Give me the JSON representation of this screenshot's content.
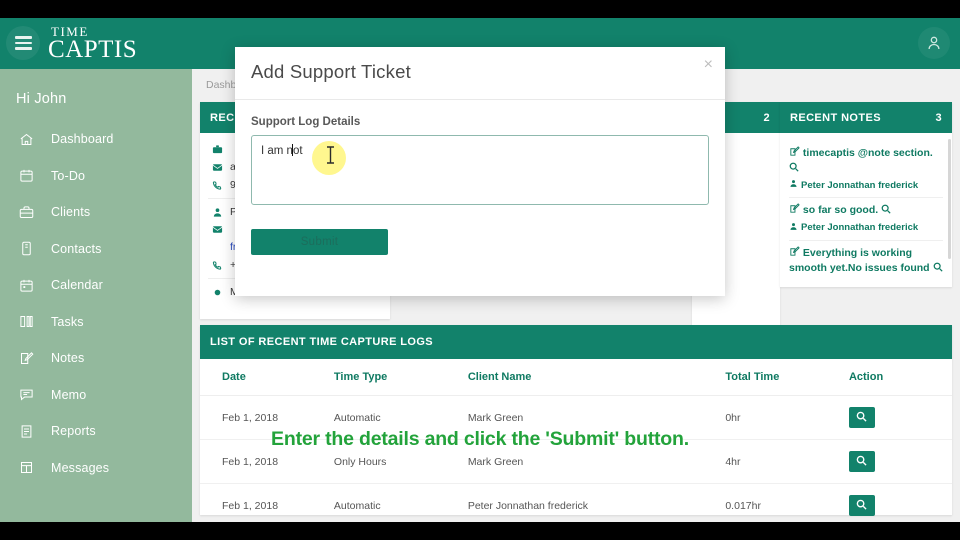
{
  "colors": {
    "brand_teal": "#12826b",
    "sidebar_sage": "#93b99d",
    "instruction_green": "#23a33b",
    "highlight_yellow": "#fff24a"
  },
  "header": {
    "brand_line1": "TIME",
    "brand_line2": "CAPTIS",
    "hamburger_icon": "hamburger-menu-icon",
    "user_icon": "user-avatar-icon"
  },
  "sidebar": {
    "greeting": "Hi John",
    "items": [
      {
        "label": "Dashboard",
        "icon": "home-icon"
      },
      {
        "label": "To-Do",
        "icon": "calendar-check-icon"
      },
      {
        "label": "Clients",
        "icon": "briefcase-icon"
      },
      {
        "label": "Contacts",
        "icon": "contact-card-icon"
      },
      {
        "label": "Calendar",
        "icon": "calendar-icon"
      },
      {
        "label": "Tasks",
        "icon": "tasks-columns-icon"
      },
      {
        "label": "Notes",
        "icon": "note-pencil-icon"
      },
      {
        "label": "Memo",
        "icon": "memo-bubble-icon"
      },
      {
        "label": "Reports",
        "icon": "report-document-icon"
      },
      {
        "label": "Messages",
        "icon": "messages-icon"
      }
    ]
  },
  "main": {
    "breadcrumb": "Dashboard",
    "contacts_card": {
      "title": "RECENT CONTACTS",
      "rows": [
        {
          "icon": "briefcase-icon",
          "text": ""
        },
        {
          "icon": "envelope-icon",
          "text": "a"
        },
        {
          "icon": "phone-icon",
          "text": "9"
        },
        {
          "icon": "person-icon",
          "text": "P"
        },
        {
          "icon": "envelope-icon",
          "text": ""
        },
        {
          "icon": "link-icon",
          "text": "fre",
          "is_link": true
        },
        {
          "icon": "phone-icon",
          "text": "+"
        },
        {
          "icon": "dot-icon",
          "text": "Mark Green"
        }
      ]
    },
    "tasks_card": {
      "badge": "2"
    },
    "notes_card": {
      "title": "RECENT NOTES",
      "badge": "3",
      "items": [
        {
          "text": "timecaptis @note section.",
          "author": "Peter Jonnathan frederick"
        },
        {
          "text": "so far so good.",
          "author": "Peter Jonnathan frederick"
        },
        {
          "text": "Everything is working smooth yet.No issues found",
          "author": ""
        }
      ]
    },
    "logs_card": {
      "title": "LIST OF RECENT TIME CAPTURE LOGS",
      "columns": [
        "Date",
        "Time Type",
        "Client Name",
        "Total Time",
        "Action"
      ],
      "rows": [
        {
          "date": "Feb 1, 2018",
          "type": "Automatic",
          "client": "Mark Green",
          "total": "0hr",
          "action_icon": "search-icon"
        },
        {
          "date": "Feb 1, 2018",
          "type": "Only Hours",
          "client": "Mark Green",
          "total": "4hr",
          "action_icon": "search-icon"
        },
        {
          "date": "Feb 1, 2018",
          "type": "Automatic",
          "client": "Peter Jonnathan frederick",
          "total": "0.017hr",
          "action_icon": "search-icon"
        }
      ]
    }
  },
  "modal": {
    "title": "Add Support Ticket",
    "close_label": "×",
    "field_label": "Support Log Details",
    "textarea_value": "I am not",
    "textarea_placeholder": "",
    "submit_label": "Submit"
  },
  "instruction": "Enter the details and click the 'Submit' button."
}
